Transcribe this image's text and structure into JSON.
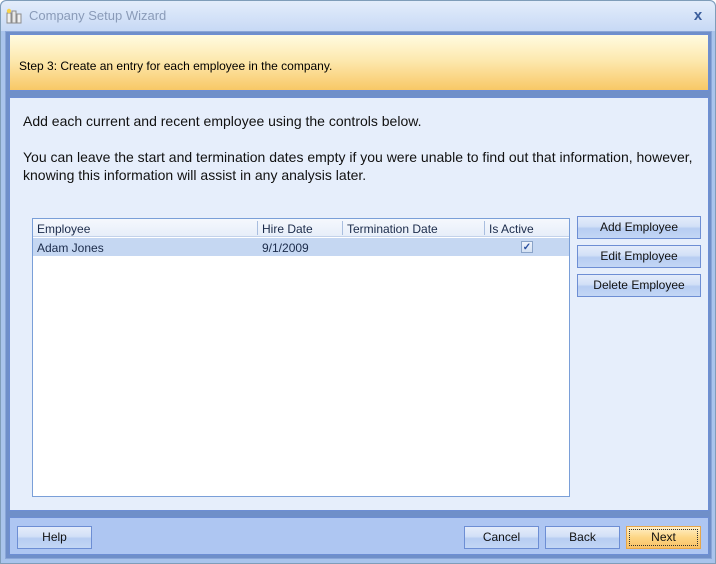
{
  "window": {
    "title": "Company Setup Wizard",
    "icon": "app-chart-icon",
    "close_glyph": "x"
  },
  "step": {
    "text": "Step 3: Create an entry for each employee in the company."
  },
  "content": {
    "intro_line1": "Add each current and recent employee using the controls below.",
    "intro_line2": "You can leave the start and termination dates empty if you were unable to find out that information, however, knowing this information will assist in any analysis later."
  },
  "grid": {
    "columns": [
      "Employee",
      "Hire Date",
      "Termination Date",
      "Is Active"
    ],
    "rows": [
      {
        "employee": "Adam Jones",
        "hire_date": "9/1/2009",
        "termination_date": "",
        "is_active": true,
        "selected": true
      }
    ]
  },
  "side_buttons": {
    "add": "Add Employee",
    "edit": "Edit Employee",
    "delete": "Delete Employee"
  },
  "footer": {
    "help": "Help",
    "cancel": "Cancel",
    "back": "Back",
    "next": "Next"
  },
  "colors": {
    "header_gradient_top": "#fffbe0",
    "header_gradient_bottom": "#f8c866",
    "content_bg": "#e6eefb",
    "frame_border": "#6d8ed4",
    "selected_row": "#c5d7f2",
    "next_button": "#fdd685"
  }
}
